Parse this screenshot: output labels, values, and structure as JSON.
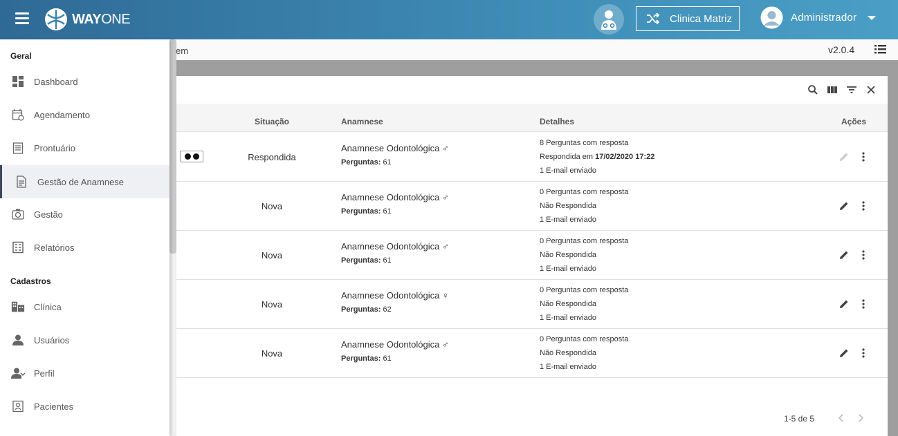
{
  "header": {
    "logo_brand": "WAYONE",
    "logo_bold": "WAY",
    "logo_light": "ONE",
    "clinic_button": "Clinica Matriz",
    "user_name": "Administrador"
  },
  "subbar": {
    "partial_text": "em",
    "version": "v2.0.4"
  },
  "sidebar": {
    "section_general": "Geral",
    "section_registers": "Cadastros",
    "items": [
      {
        "label": "Dashboard",
        "icon": "dashboard-icon"
      },
      {
        "label": "Agendamento",
        "icon": "calendar-icon"
      },
      {
        "label": "Prontuário",
        "icon": "clipboard-icon"
      },
      {
        "label": "Gestão de Anamnese",
        "icon": "document-icon",
        "active": true
      },
      {
        "label": "Gestão",
        "icon": "camera-icon"
      },
      {
        "label": "Relatórios",
        "icon": "report-icon"
      },
      {
        "label": "Clínica",
        "icon": "building-icon"
      },
      {
        "label": "Usuários",
        "icon": "user-icon"
      },
      {
        "label": "Perfil",
        "icon": "profile-icon"
      },
      {
        "label": "Pacientes",
        "icon": "patient-icon"
      }
    ]
  },
  "table": {
    "headers": {
      "situacao": "Situação",
      "anamnese": "Anamnese",
      "detalhes": "Detalhes",
      "acoes": "Ações"
    },
    "rows": [
      {
        "situacao": "Respondida",
        "anamnese": "Anamnese Odontológica ♂",
        "perguntas_label": "Perguntas:",
        "perguntas": "61",
        "d1": "8 Perguntas com resposta",
        "d2_prefix": "Respondida em ",
        "d2_bold": "17/02/2020 17:22",
        "d3": "1 E-mail enviado",
        "edit_disabled": true,
        "toggle": true
      },
      {
        "situacao": "Nova",
        "anamnese": "Anamnese Odontológica ♂",
        "perguntas_label": "Perguntas:",
        "perguntas": "61",
        "d1": "0 Perguntas com resposta",
        "d2_prefix": "Não Respondida",
        "d2_bold": "",
        "d3": "1 E-mail enviado"
      },
      {
        "situacao": "Nova",
        "anamnese": "Anamnese Odontológica ♂",
        "perguntas_label": "Perguntas:",
        "perguntas": "61",
        "d1": "0 Perguntas com resposta",
        "d2_prefix": "Não Respondida",
        "d2_bold": "",
        "d3": "1 E-mail enviado"
      },
      {
        "situacao": "Nova",
        "anamnese": "Anamnese Odontológica ♀",
        "perguntas_label": "Perguntas:",
        "perguntas": "62",
        "d1": "0 Perguntas com resposta",
        "d2_prefix": "Não Respondida",
        "d2_bold": "",
        "d3": "1 E-mail enviado"
      },
      {
        "situacao": "Nova",
        "anamnese": "Anamnese Odontológica ♂",
        "perguntas_label": "Perguntas:",
        "perguntas": "61",
        "d1": "0 Perguntas com resposta",
        "d2_prefix": "Não Respondida",
        "d2_bold": "",
        "d3": "1 E-mail enviado"
      }
    ],
    "pagination": "1-5 de 5"
  },
  "colors": {
    "header_start": "#2f6a96",
    "header_end": "#4a9fc6",
    "overlay": "#9e9e9e"
  }
}
